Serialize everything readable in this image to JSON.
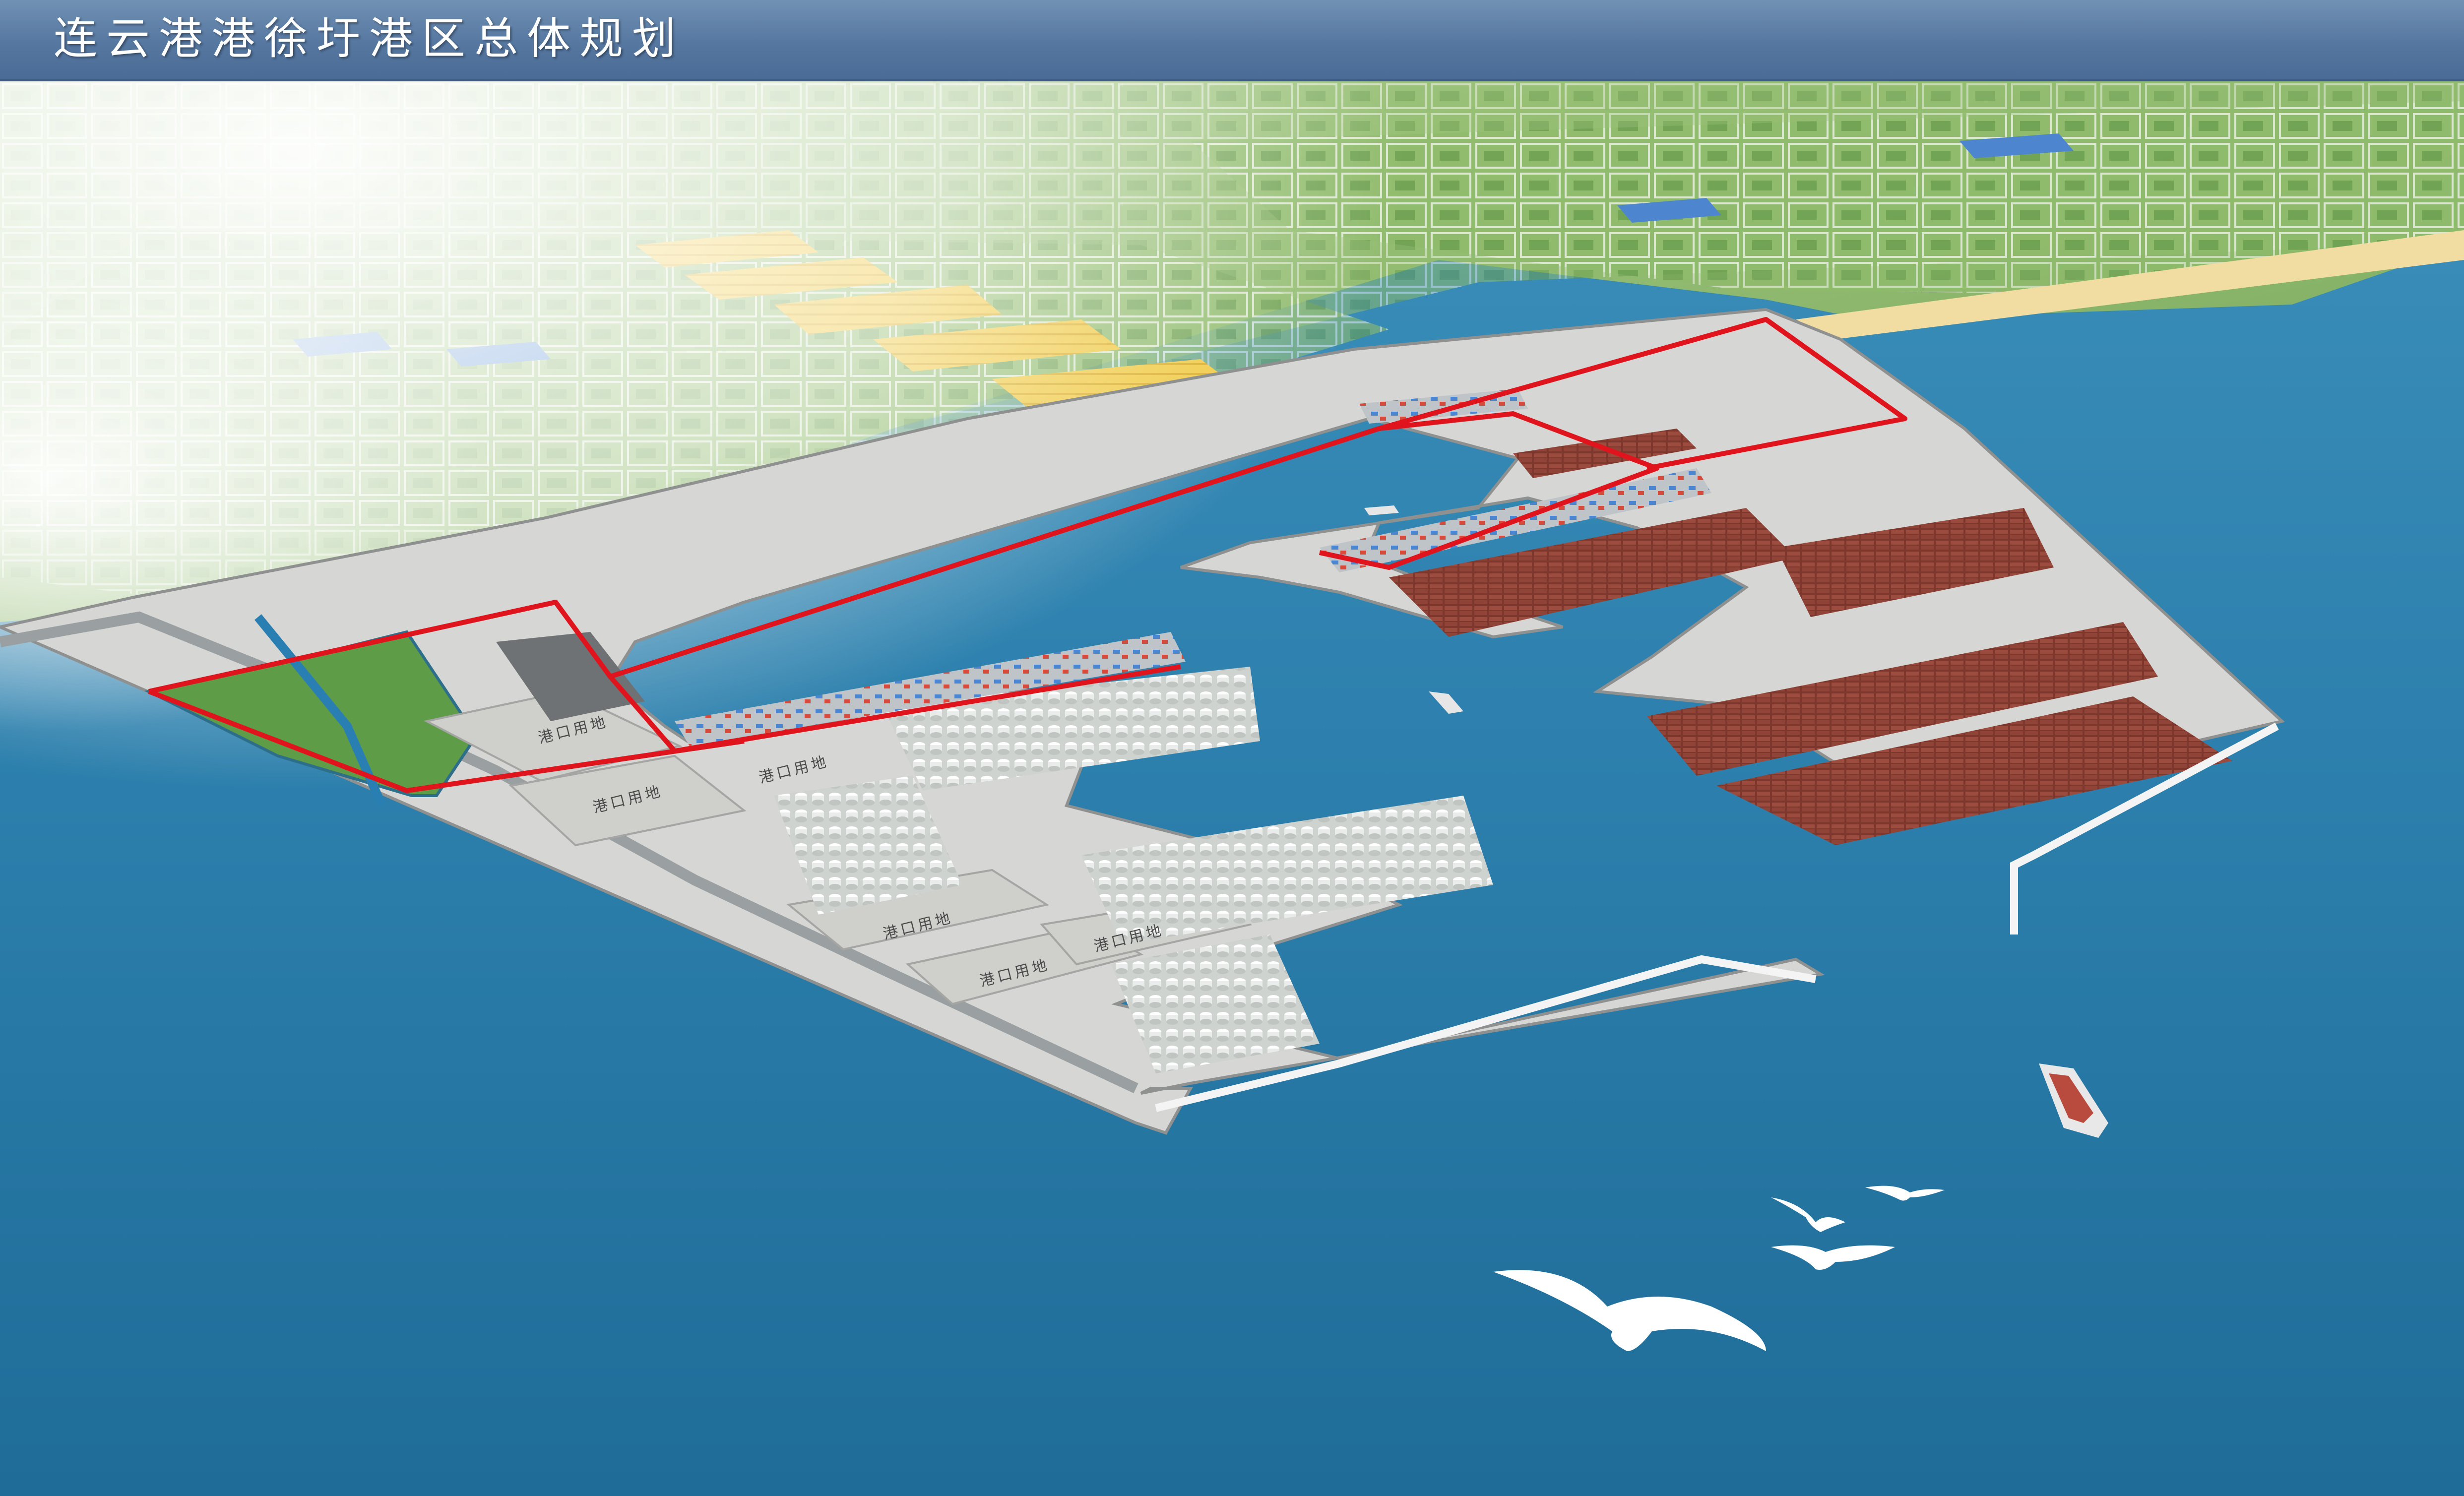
{
  "header": {
    "title": "连云港港徐圩港区总体规划"
  },
  "map": {
    "plot_label": "港口用地",
    "plot_label_count": 6,
    "colors": {
      "sea": "#2f82ad",
      "sea_deep": "#1f6b97",
      "land_green": "#8ab866",
      "port_land": "#d6d6d4",
      "red_boundary": "#e0141c",
      "container_brown": "#8b3f33",
      "breakwater": "#f4f4f4",
      "header_bar": "#5677a0"
    }
  }
}
